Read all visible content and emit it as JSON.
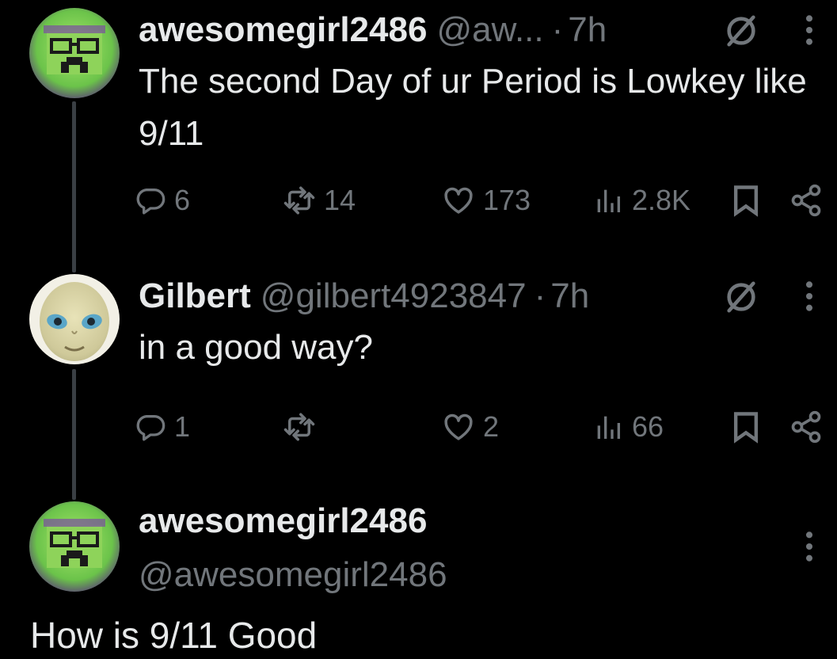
{
  "tweets": [
    {
      "display_name": "awesomegirl2486",
      "handle": "@aw...",
      "separator": "·",
      "time": "7h",
      "text": "The second Day of ur Period is Lowkey like 9/11",
      "stats": {
        "replies": "6",
        "reposts": "14",
        "likes": "173",
        "views": "2.8K"
      }
    },
    {
      "display_name": "Gilbert",
      "handle": "@gilbert4923847",
      "separator": "·",
      "time": "7h",
      "text": "in a good way?",
      "stats": {
        "replies": "1",
        "reposts": "",
        "likes": "2",
        "views": "66"
      }
    }
  ],
  "focused_reply": {
    "display_name": "awesomegirl2486",
    "handle": "@awesomegirl2486",
    "text": "How is 9/11 Good"
  },
  "icons": {
    "reply": "speech-bubble-icon",
    "repost": "repost-arrows-icon",
    "like": "heart-icon",
    "views": "bar-chart-icon",
    "bookmark": "bookmark-icon",
    "share": "share-icon",
    "grok": "slashed-circle-icon",
    "more": "vertical-dots-icon"
  },
  "colors": {
    "background": "#000000",
    "primary_text": "#e7e9ea",
    "secondary_text": "#71767b",
    "thread_line": "#3a3f44"
  }
}
